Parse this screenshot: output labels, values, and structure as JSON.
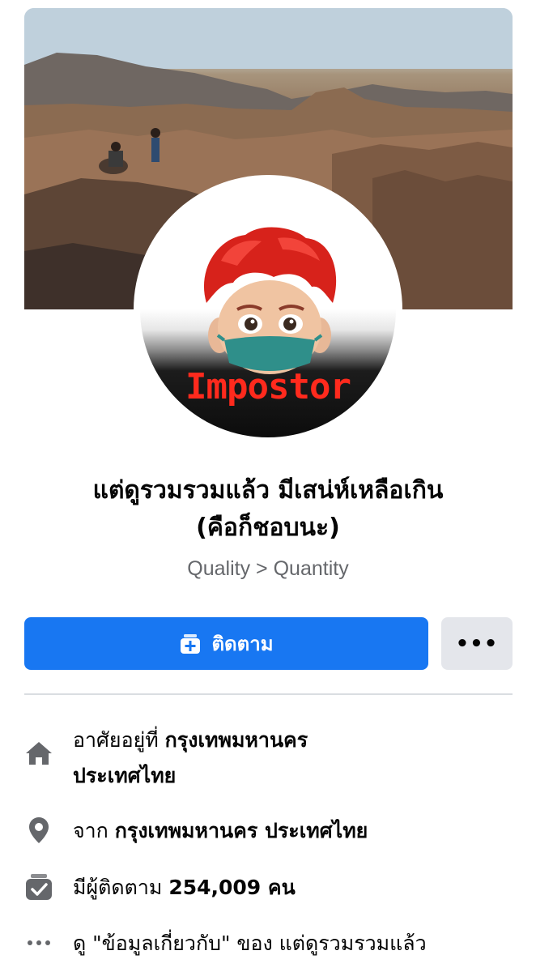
{
  "profile": {
    "name_line1": "แต่ดูรวมรวมแล้ว มีเสน่ห์เหลือเกิน",
    "name_line2": "(คือก็ชอบนะ)",
    "tagline": "Quality > Quantity",
    "avatar_caption": "Impostor"
  },
  "actions": {
    "follow_label": "ติดตาม",
    "more_label": "•••"
  },
  "info": {
    "lives_prefix": "อาศัยอยู่ที่ ",
    "lives_city": "กรุงเทพมหานคร",
    "lives_country": "ประเทศไทย",
    "from_prefix": "จาก ",
    "from_place": "กรุงเทพมหานคร ประเทศไทย",
    "followers_prefix": "มีผู้ติดตาม ",
    "followers_count": "254,009 คน",
    "about_text": "ดู \"ข้อมูลเกี่ยวกับ\" ของ แต่ดูรวมรวมแล้ว"
  },
  "icons": {
    "home": "home-icon",
    "location": "location-pin-icon",
    "followers": "followers-check-icon",
    "more": "ellipsis-icon"
  },
  "colors": {
    "primary": "#1877f2",
    "secondary_button": "#e4e6eb",
    "icon_gray": "#65676b",
    "impostor_red": "#ff2a1d"
  }
}
